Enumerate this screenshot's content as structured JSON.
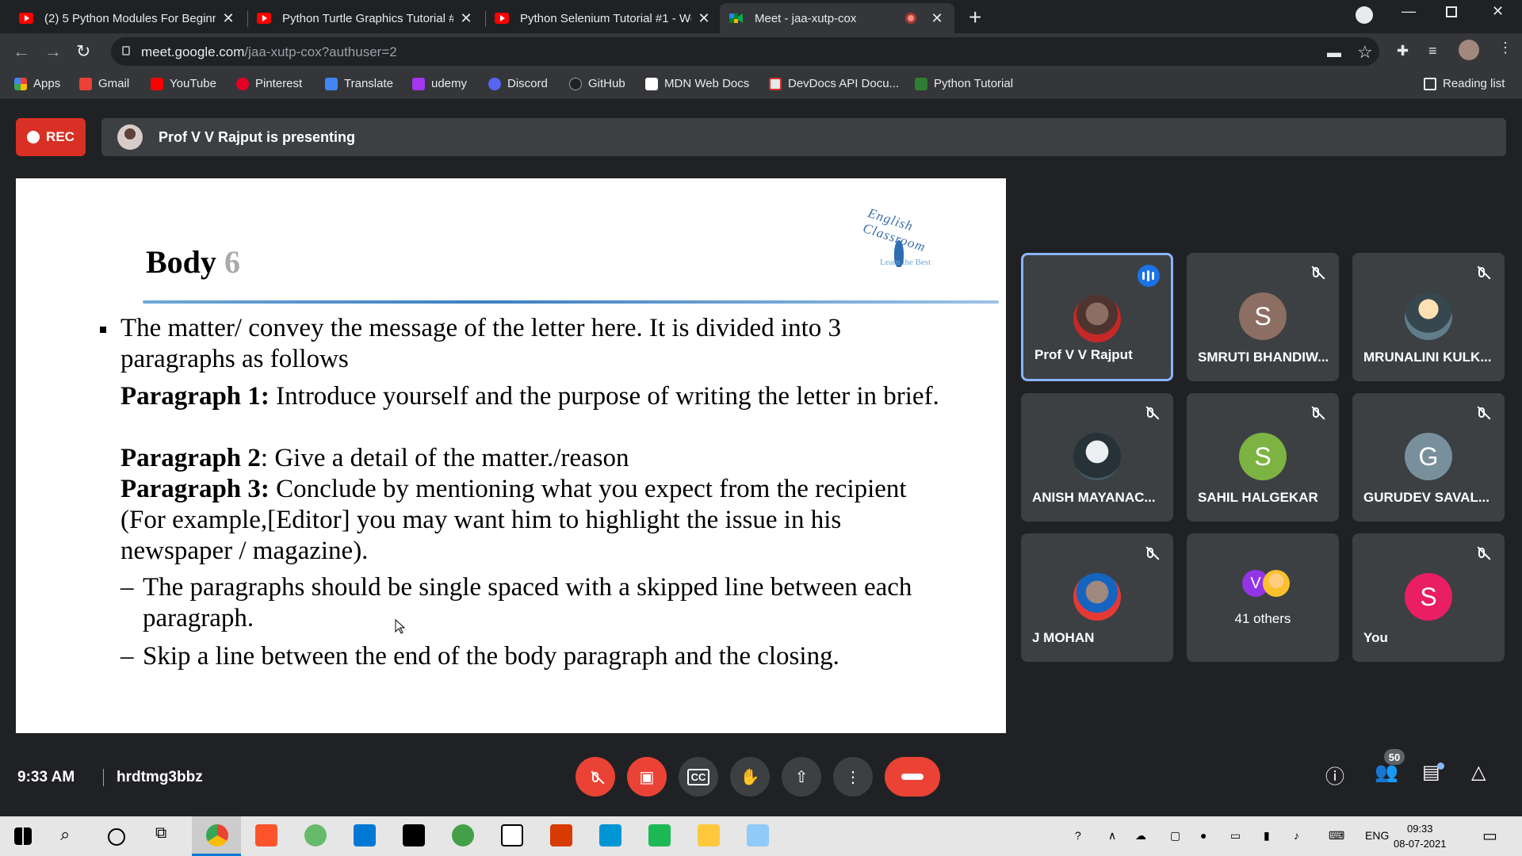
{
  "browser": {
    "tabs": [
      {
        "title": "(2) 5 Python Modules For Beginn"
      },
      {
        "title": "Python Turtle Graphics Tutorial #"
      },
      {
        "title": "Python Selenium Tutorial #1 - We"
      },
      {
        "title": "Meet - jaa-xutp-cox"
      }
    ],
    "new_tab": "+",
    "url_host": "meet.google.com",
    "url_path": "/jaa-xutp-cox?authuser=2",
    "bookmarks": [
      "Apps",
      "Gmail",
      "YouTube",
      "Pinterest",
      "Translate",
      "udemy",
      "Discord",
      "GitHub",
      "MDN Web Docs",
      "DevDocs API Docu...",
      "Python Tutorial"
    ],
    "reading_list": "Reading list"
  },
  "meet": {
    "rec_label": "REC",
    "presenting": "Prof V V Rajput is presenting",
    "slide": {
      "title": "Body",
      "title_num": "6",
      "logo_text": "English Classroom",
      "logo_tagline": "Learn the Best",
      "intro": "The matter/ convey the message of the letter here. It is divided into 3 paragraphs as follows",
      "p1_label": "Paragraph 1:",
      "p1_text": " Introduce yourself and the purpose of writing the letter in brief.",
      "p2_label": "Paragraph 2",
      "p2_text": ": Give a detail of the matter./reason",
      "p3_label": "Paragraph 3:",
      "p3_text": " Conclude by mentioning what you expect from the recipient (For example,[Editor] you may want him to highlight the issue in his newspaper / magazine).",
      "dash1": "The paragraphs should be single spaced with a skipped line between each paragraph.",
      "dash2": "Skip a line between the end of the body paragraph and the closing."
    },
    "participants": [
      {
        "name": "Prof V V Rajput"
      },
      {
        "name": "SMRUTI BHANDIW...",
        "initial": "S",
        "color": "#8d6e63"
      },
      {
        "name": "MRUNALINI KULK..."
      },
      {
        "name": "ANISH MAYANAC..."
      },
      {
        "name": "SAHIL HALGEKAR",
        "initial": "S",
        "color": "#7cb342"
      },
      {
        "name": "GURUDEV SAVAL...",
        "initial": "G",
        "color": "#78909c"
      },
      {
        "name": "J MOHAN"
      },
      {
        "name": "41 others",
        "initial": "V"
      },
      {
        "name": "You",
        "initial": "S",
        "color": "#e91e63"
      }
    ],
    "time": "9:33 AM",
    "meeting_code": "hrdtmg3bbz",
    "people_count": "50"
  },
  "taskbar": {
    "lang": "ENG",
    "time": "09:33",
    "date": "08-07-2021"
  }
}
